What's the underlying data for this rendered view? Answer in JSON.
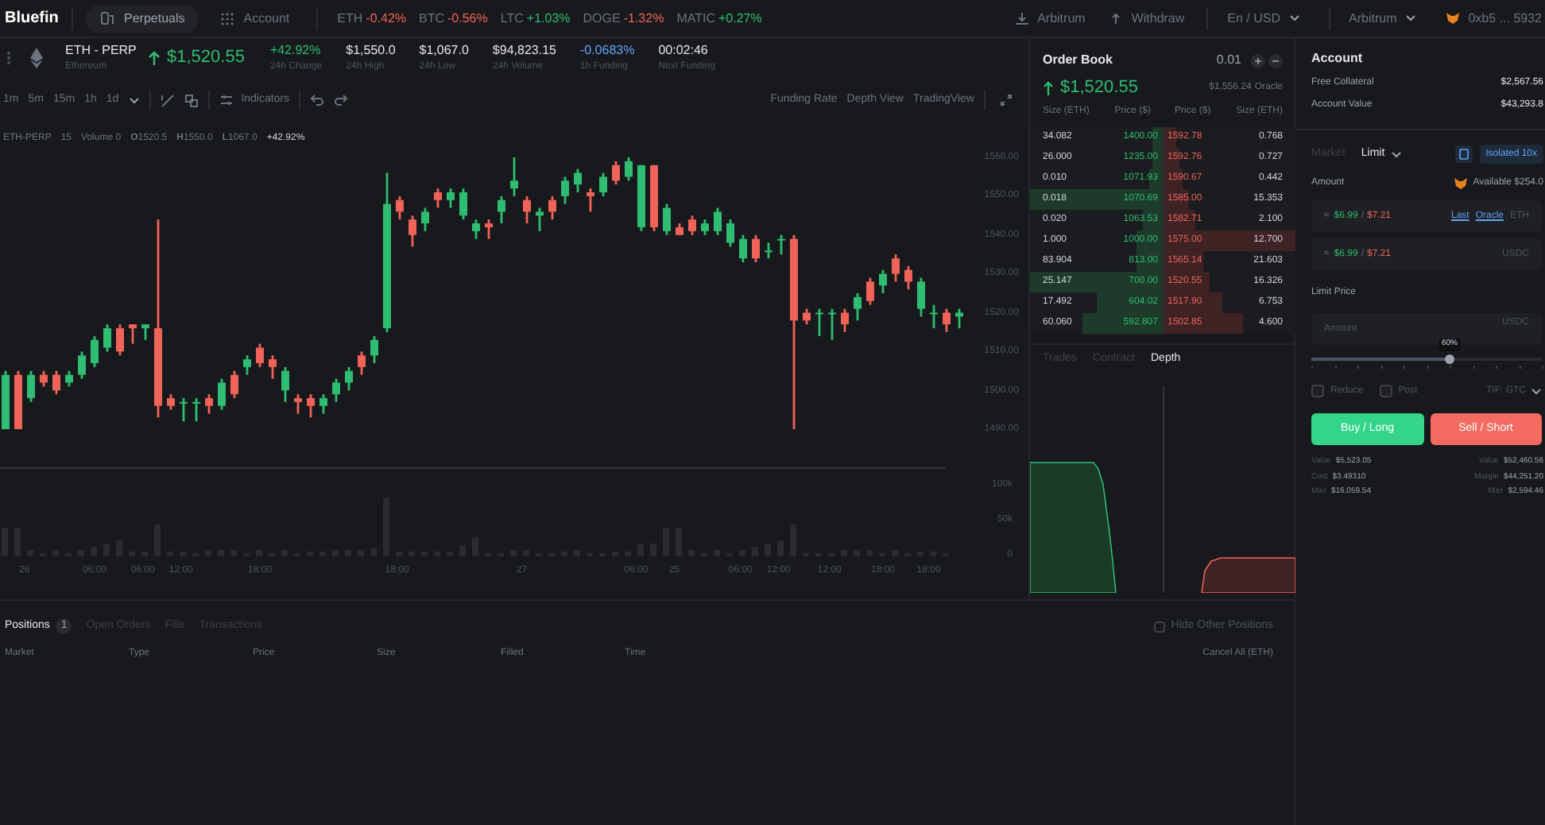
{
  "nav": {
    "logo": "Bluefin",
    "tabs": [
      {
        "label": "Perpetuals",
        "kind": "perpetuals",
        "selected": true
      },
      {
        "label": "Account",
        "kind": "account",
        "selected": false
      }
    ],
    "tickers": [
      {
        "symbol": "ETH",
        "change": "-0.42%",
        "color": "#ef6358"
      },
      {
        "symbol": "BTC",
        "change": "-0.56%",
        "color": "#ef6358"
      },
      {
        "symbol": "LTC",
        "change": "+1.03%",
        "color": "#2ebd72"
      },
      {
        "symbol": "DOGE",
        "change": "-1.32%",
        "color": "#ef6358"
      },
      {
        "symbol": "MATIC",
        "change": "+0.27%",
        "color": "#2ebd72"
      }
    ],
    "actions": [
      {
        "label": "Arbitrum",
        "kind": "deposit"
      },
      {
        "label": "Withdraw",
        "kind": "withdraw"
      }
    ],
    "language": "En / USD",
    "network": "Arbitrum",
    "wallet": "0xb5 ... 5932"
  },
  "market": {
    "symbol": "ETH - PERP",
    "name": "Ethereum",
    "price": "$1,520.55",
    "stats": [
      {
        "value": "+42.92%",
        "label": "24h Change",
        "color": "#2ebd72"
      },
      {
        "value": "$1,550.0",
        "label": "24h High",
        "color": "#e5e7eb"
      },
      {
        "value": "$1,067.0",
        "label": "24h Low",
        "color": "#e5e7eb"
      },
      {
        "value": "$94,823.15",
        "label": "24h Volume",
        "color": "#e5e7eb"
      },
      {
        "value": "-0.0683%",
        "label": "1h Funding",
        "color": "#60a5fa"
      },
      {
        "value": "00:02:46",
        "label": "Next Funding",
        "color": "#e5e7eb"
      }
    ]
  },
  "chart_toolbar": {
    "intervals": [
      "1m",
      "5m",
      "15m",
      "1h",
      "1d"
    ],
    "indicators": "Indicators",
    "views": [
      "Funding Rate",
      "Depth View",
      "TradingView"
    ]
  },
  "chart": {
    "legend": [
      "ETH-PERP",
      "15",
      "Volume 0",
      "**O**1520.5",
      "**H**1550.0",
      "**L**1067.0",
      "+42.92%"
    ],
    "chart_data": {
      "type": "candlestick",
      "ohlc": [
        [
          1490,
          1505,
          1490,
          1504
        ],
        [
          1504,
          1505,
          1490,
          1490
        ],
        [
          1498,
          1505,
          1497,
          1504
        ],
        [
          1504,
          1505,
          1501,
          1502
        ],
        [
          1504,
          1505,
          1499,
          1500
        ],
        [
          1502,
          1505,
          1501,
          1504
        ],
        [
          1504,
          1510,
          1503,
          1509
        ],
        [
          1507,
          1514,
          1506,
          1513
        ],
        [
          1511,
          1517,
          1510,
          1516
        ],
        [
          1516,
          1517,
          1509,
          1510
        ],
        [
          1517,
          1517,
          1512,
          1516
        ],
        [
          1516,
          1517,
          1513,
          1517
        ],
        [
          1516,
          1544,
          1493,
          1496
        ],
        [
          1498,
          1499,
          1495,
          1496
        ],
        [
          1497,
          1498,
          1492,
          1497
        ],
        [
          1497,
          1498,
          1492,
          1497
        ],
        [
          1498,
          1499,
          1494,
          1496
        ],
        [
          1496,
          1503,
          1495,
          1502
        ],
        [
          1504,
          1505,
          1498,
          1499
        ],
        [
          1506,
          1509,
          1504,
          1508
        ],
        [
          1511,
          1512,
          1506,
          1507
        ],
        [
          1508,
          1509,
          1503,
          1506
        ],
        [
          1500,
          1506,
          1497,
          1505
        ],
        [
          1498,
          1499,
          1494,
          1497
        ],
        [
          1498,
          1499,
          1493,
          1496
        ],
        [
          1496,
          1499,
          1494,
          1498
        ],
        [
          1499,
          1503,
          1497,
          1502
        ],
        [
          1502,
          1506,
          1500,
          1505
        ],
        [
          1509,
          1510,
          1504,
          1506
        ],
        [
          1509,
          1514,
          1507,
          1513
        ],
        [
          1516,
          1556,
          1515,
          1548
        ],
        [
          1549,
          1550,
          1544,
          1546
        ],
        [
          1544,
          1545,
          1537,
          1540
        ],
        [
          1543,
          1547,
          1541,
          1546
        ],
        [
          1551,
          1552,
          1547,
          1549
        ],
        [
          1549,
          1552,
          1547,
          1551
        ],
        [
          1545,
          1552,
          1544,
          1551
        ],
        [
          1541,
          1544,
          1539,
          1543
        ],
        [
          1543,
          1544,
          1539,
          1542
        ],
        [
          1546,
          1550,
          1543,
          1549
        ],
        [
          1552,
          1560,
          1550,
          1554
        ],
        [
          1549,
          1550,
          1543,
          1546
        ],
        [
          1545,
          1547,
          1541,
          1546
        ],
        [
          1549,
          1550,
          1544,
          1546
        ],
        [
          1550,
          1555,
          1548,
          1554
        ],
        [
          1553,
          1557,
          1551,
          1556
        ],
        [
          1551,
          1552,
          1546,
          1550
        ],
        [
          1551,
          1556,
          1550,
          1555
        ],
        [
          1558,
          1559,
          1553,
          1554
        ],
        [
          1555,
          1560,
          1554,
          1559
        ],
        [
          1542,
          1558,
          1541,
          1558
        ],
        [
          1558,
          1558,
          1541,
          1542
        ],
        [
          1541,
          1548,
          1540,
          1547
        ],
        [
          1542,
          1543,
          1540,
          1540
        ],
        [
          1544,
          1545,
          1540,
          1541
        ],
        [
          1541,
          1544,
          1540,
          1543
        ],
        [
          1541,
          1547,
          1540,
          1546
        ],
        [
          1538,
          1544,
          1537,
          1543
        ],
        [
          1534,
          1540,
          1533,
          1539
        ],
        [
          1539,
          1540,
          1533,
          1534
        ],
        [
          1536,
          1538,
          1534,
          1536
        ],
        [
          1539,
          1540,
          1535,
          1539
        ],
        [
          1539,
          1540,
          1490,
          1518
        ],
        [
          1520,
          1521,
          1517,
          1518
        ],
        [
          1520,
          1521,
          1514,
          1520
        ],
        [
          1520,
          1521,
          1513,
          1520
        ],
        [
          1520,
          1521,
          1515,
          1517
        ],
        [
          1521,
          1525,
          1518,
          1524
        ],
        [
          1528,
          1529,
          1522,
          1523
        ],
        [
          1527,
          1531,
          1525,
          1530
        ],
        [
          1534,
          1535,
          1528,
          1530
        ],
        [
          1531,
          1532,
          1526,
          1528
        ],
        [
          1521,
          1529,
          1519,
          1528
        ],
        [
          1520,
          1522,
          1516,
          1520
        ],
        [
          1520,
          1521,
          1515,
          1517
        ],
        [
          1519,
          1521,
          1516,
          1520
        ]
      ],
      "ylim": [
        1490,
        1560
      ],
      "yticks": [
        {
          "value": 1560,
          "label": "1560.00"
        },
        {
          "value": 1550,
          "label": "1550.00"
        },
        {
          "value": 1540,
          "label": "1540.00"
        },
        {
          "value": 1530,
          "label": "1530.00"
        },
        {
          "value": 1520,
          "label": "1520.00"
        },
        {
          "value": 1510,
          "label": "1510.00"
        },
        {
          "value": 1500,
          "label": "1500.00"
        },
        {
          "value": 1490,
          "label": "1490.00"
        }
      ]
    },
    "volume_ticks": [
      "100k",
      "50k",
      "0"
    ],
    "time_labels": [
      "26",
      "06:00",
      "06:00",
      "12:00",
      "18:00",
      "18:00",
      "27",
      "06:00",
      "25",
      "06:00",
      "12:00",
      "12:00",
      "18:00",
      "18:00"
    ]
  },
  "order_book": {
    "title": "Order Book",
    "tick_size": "0.01",
    "last_price": "$1,520.55",
    "oracle_price": "$1,556.24",
    "oracle_label": "Oracle",
    "columns": [
      "Size (ETH)",
      "Price ($)",
      "Price ($)",
      "Size (ETH)"
    ],
    "rows": [
      {
        "bid": {
          "size": "34.082",
          "price": "1400.00",
          "level": 0.08
        },
        "ask": {
          "price": "1592.78",
          "size": "0.768",
          "level": 0.1
        }
      },
      {
        "bid": {
          "size": "26.000",
          "price": "1235.00",
          "level": 0.08
        },
        "ask": {
          "price": "1592.76",
          "size": "0.727",
          "level": 0.12
        }
      },
      {
        "bid": {
          "size": "0.010",
          "price": "1071.93",
          "level": 0.1
        },
        "ask": {
          "price": "1590.67",
          "size": "0.442",
          "level": 0.15
        }
      },
      {
        "bid": {
          "size": "0.018",
          "price": "1070.69",
          "level": 1
        },
        "ask": {
          "price": "1585.00",
          "size": "15.353",
          "level": 0.2
        }
      },
      {
        "bid": {
          "size": "0.020",
          "price": "1063.53",
          "level": 0.15
        },
        "ask": {
          "price": "1582.71",
          "size": "2.100",
          "level": 0.25
        }
      },
      {
        "bid": {
          "size": "1.000",
          "price": "1000.00",
          "level": 0.2
        },
        "ask": {
          "price": "1575.00",
          "size": "12.700",
          "level": 1
        }
      },
      {
        "bid": {
          "size": "83.904",
          "price": "813.00",
          "level": 0.2
        },
        "ask": {
          "price": "1565.14",
          "size": "21.603",
          "level": 0.3
        }
      },
      {
        "bid": {
          "size": "25.147",
          "price": "700.00",
          "level": 1
        },
        "ask": {
          "price": "1520.55",
          "size": "16.326",
          "level": 0.35
        }
      },
      {
        "bid": {
          "size": "17.492",
          "price": "604.02",
          "level": 0.5
        },
        "ask": {
          "price": "1517.90",
          "size": "6.753",
          "level": 0.45
        }
      },
      {
        "bid": {
          "size": "60.060",
          "price": "592.807",
          "level": 0.6
        },
        "ask": {
          "price": "1502.85",
          "size": "4.600",
          "level": 0.6
        }
      }
    ],
    "tabs": [
      {
        "label": "Trades",
        "selected": false
      },
      {
        "label": "Contract",
        "selected": false
      },
      {
        "label": "Depth",
        "selected": true
      }
    ]
  },
  "account": {
    "title": "Account",
    "rows": [
      {
        "label": "Free Collateral",
        "value": "$2,567.56"
      },
      {
        "label": "Account Value",
        "value": "$43,293.8"
      }
    ]
  },
  "order_form": {
    "order_types": [
      {
        "label": "Market",
        "selected": false
      },
      {
        "label": "Limit",
        "selected": true
      }
    ],
    "margin_mode": "Isolated 10x",
    "amount_label": "Amount",
    "available": "Available $254.0",
    "amount_fields": [
      {
        "approx": "≈",
        "bid": "$6.99",
        "separator": "/",
        "ask": "$7.21",
        "links": [
          "Last",
          "Oracle"
        ],
        "unit": "ETH"
      },
      {
        "approx": "≈",
        "bid": "$6.99",
        "separator": "/",
        "ask": "$7.21",
        "unit": "USDC"
      }
    ],
    "limit_label": "Limit Price",
    "limit_field": {
      "placeholder": "Amount",
      "unit": "USDC"
    },
    "slider": {
      "tooltip": "60%",
      "level": 0.6
    },
    "options": [
      {
        "label": "Reduce",
        "checked": false
      },
      {
        "label": "Post",
        "checked": false
      }
    ],
    "tif": "TIF: GTC",
    "buy": "Buy / Long",
    "sell": "Sell / Short",
    "summary": {
      "buy": [
        {
          "label": "Value",
          "value": "$5,523.05"
        },
        {
          "label": "Cost",
          "value": "$3.49310"
        },
        {
          "label": "Max",
          "value": "$16,059.54"
        }
      ],
      "sell": [
        {
          "label": "Value",
          "value": "$52,460.56"
        },
        {
          "label": "Margin",
          "value": "$44,251.20"
        },
        {
          "label": "Max",
          "value": "$2,594.46"
        }
      ]
    }
  },
  "positions": {
    "tabs": [
      {
        "label": "Positions",
        "badge": "1",
        "selected": true
      },
      {
        "label": "Open Orders",
        "selected": false
      },
      {
        "label": "Fills",
        "selected": false
      },
      {
        "label": "Transactions",
        "selected": false
      }
    ],
    "hide_other": {
      "label": "Hide Other Positions",
      "checked": false
    },
    "columns": [
      "Market",
      "Type",
      "Price",
      "Size",
      "Filled",
      "Time"
    ],
    "cancel_all": "Cancel All (ETH)"
  }
}
